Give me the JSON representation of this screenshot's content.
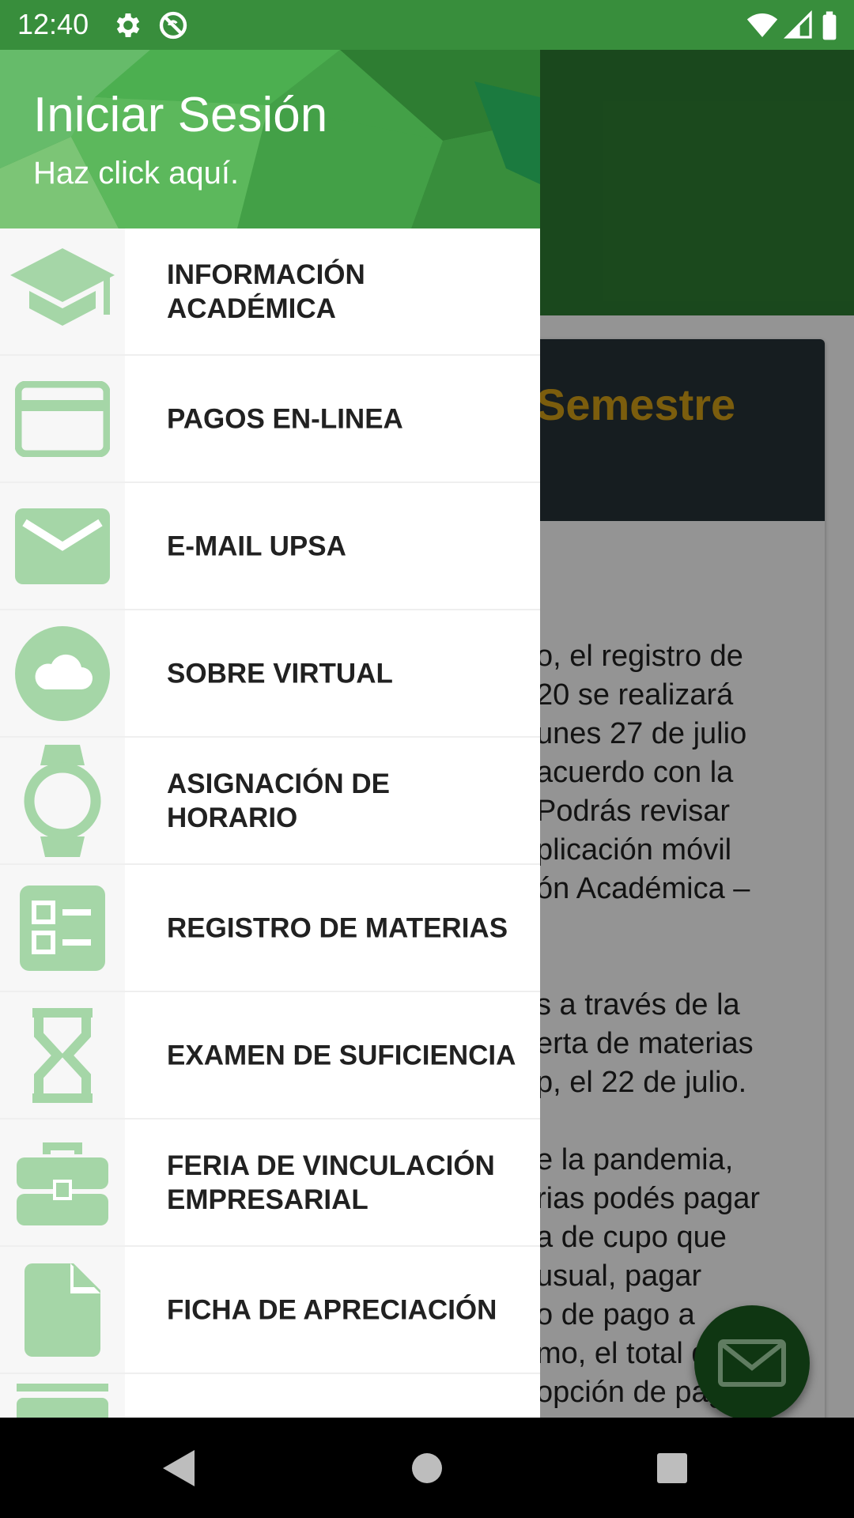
{
  "status_bar": {
    "time": "12:40",
    "icons": [
      "gear-icon",
      "sync-disabled-icon",
      "wifi-icon",
      "signal-icon",
      "battery-icon"
    ]
  },
  "drawer": {
    "header": {
      "title": "Iniciar Sesión",
      "subtitle": "Haz click aquí."
    },
    "items": [
      {
        "label": "INFORMACIÓN ACADÉMICA",
        "icon": "graduation-cap-icon"
      },
      {
        "label": "PAGOS EN-LINEA",
        "icon": "credit-card-icon"
      },
      {
        "label": "E-MAIL UPSA",
        "icon": "mail-icon"
      },
      {
        "label": "SOBRE VIRTUAL",
        "icon": "cloud-icon"
      },
      {
        "label": "ASIGNACIÓN DE HORARIO",
        "icon": "watch-icon"
      },
      {
        "label": "REGISTRO DE MATERIAS",
        "icon": "checklist-icon"
      },
      {
        "label": "EXAMEN DE SUFICIENCIA",
        "icon": "hourglass-icon"
      },
      {
        "label": "FERIA DE VINCULACIÓN EMPRESARIAL",
        "icon": "briefcase-icon"
      },
      {
        "label": "FICHA DE APRECIACIÓN",
        "icon": "file-icon"
      }
    ]
  },
  "background": {
    "card_title": "Semestre",
    "lines": [
      "o, el registro de",
      "20 se realizará",
      "unes 27 de julio",
      "acuerdo con la",
      "Podrás revisar",
      "plicación móvil",
      "ón Académica –",
      "s a través de la",
      "erta de materias",
      "p, el 22 de julio.",
      "e la pandemia,",
      "rias podés pagar",
      "a de cupo que",
      "usual, pagar",
      "o de pago a",
      "mo, el total d",
      "opción de pago"
    ]
  },
  "colors": {
    "primary": "#388e3c",
    "icon_tint": "#a5d6a7",
    "accent_text": "#d4a017"
  }
}
